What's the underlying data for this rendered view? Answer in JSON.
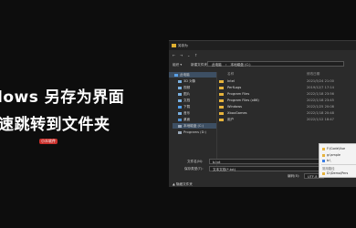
{
  "banner": {
    "title_line1": "lows 另存为界面",
    "title_line2": "速跳转到文件夹",
    "badge": "小众软件"
  },
  "dialog": {
    "title": "另存为",
    "address_parts": [
      "此电脑",
      "本地磁盘 (C:)"
    ],
    "toolbar": {
      "organize": "组织 ▾",
      "new_folder": "新建文件夹"
    },
    "sidebar": [
      {
        "label": "此电脑",
        "selected": true,
        "color": "#5aa0e6"
      },
      {
        "label": "3D 对象",
        "selected": false,
        "color": "#7ab0e0"
      },
      {
        "label": "视频",
        "selected": false,
        "color": "#7ab0e0"
      },
      {
        "label": "图片",
        "selected": false,
        "color": "#7ab0e0"
      },
      {
        "label": "文档",
        "selected": false,
        "color": "#7ab0e0"
      },
      {
        "label": "下载",
        "selected": false,
        "color": "#4fa0f0"
      },
      {
        "label": "音乐",
        "selected": false,
        "color": "#7ab0e0"
      },
      {
        "label": "桌面",
        "selected": false,
        "color": "#4f8fd0"
      },
      {
        "label": "本地磁盘 (C:)",
        "selected": true,
        "color": "#9aa8b8"
      },
      {
        "label": "Programs (D:)",
        "selected": false,
        "color": "#9aa8b8"
      }
    ],
    "columns": {
      "name": "名称",
      "date": "修改日期"
    },
    "files": [
      {
        "name": "Intel",
        "date": "2021/5/24 21:00"
      },
      {
        "name": "PerfLogs",
        "date": "2019/12/7 17:14"
      },
      {
        "name": "Program Files",
        "date": "2022/1/18 23:56"
      },
      {
        "name": "Program Files (x86)",
        "date": "2022/1/18 23:45"
      },
      {
        "name": "Windows",
        "date": "2022/1/25 20:08"
      },
      {
        "name": "XboxGames",
        "date": "2022/1/18 20:48"
      },
      {
        "name": "用户",
        "date": "2022/1/12 18:47"
      }
    ],
    "filename_label": "文件名(N):",
    "filename_value": "b.txt",
    "savetype_label": "保存类型(T):",
    "savetype_value": "文本文档(*.txt)",
    "encoding_label": "编码(E):",
    "encoding_value": "UTF-8",
    "hide_folders": "▲ 隐藏文件夹"
  },
  "popup": {
    "items": [
      {
        "label": "F:\\Code\\Vue",
        "color": "#e6b33c",
        "grey": false
      },
      {
        "label": "g:\\ample",
        "color": "#e6b33c",
        "grey": false
      },
      {
        "label": "b:\\",
        "color": "#3c7fe6",
        "grey": false
      },
      {
        "label": "常用路径",
        "color": "",
        "grey": true
      },
      {
        "label": "D:\\Demo\\Pers",
        "color": "#e6b33c",
        "grey": false
      }
    ]
  }
}
